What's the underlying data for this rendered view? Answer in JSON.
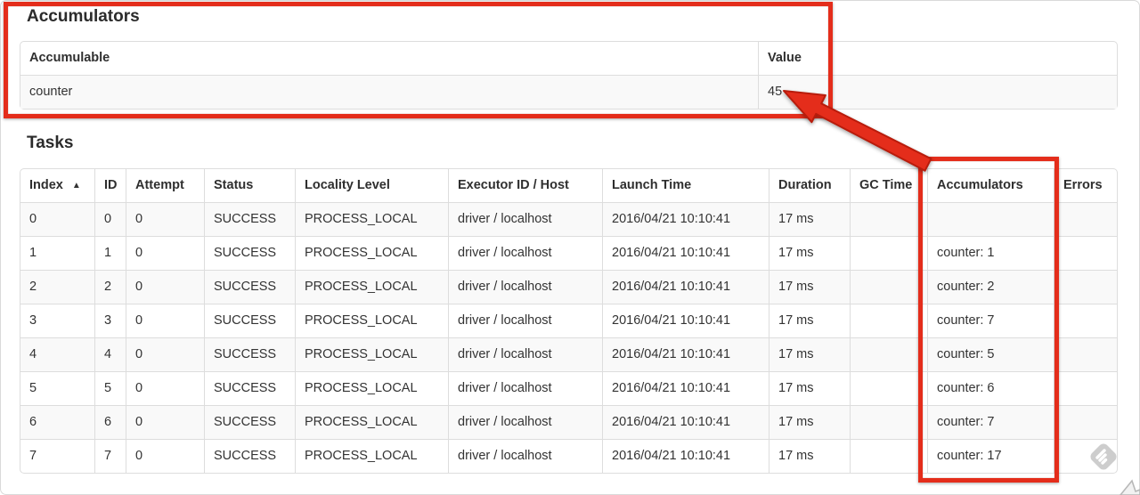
{
  "accumulators_section": {
    "title": "Accumulators",
    "table": {
      "columns": [
        "Accumulable",
        "Value"
      ],
      "rows": [
        [
          "counter",
          "45"
        ]
      ]
    }
  },
  "tasks_section": {
    "title": "Tasks",
    "table": {
      "columns": [
        "Index",
        "ID",
        "Attempt",
        "Status",
        "Locality Level",
        "Executor ID / Host",
        "Launch Time",
        "Duration",
        "GC Time",
        "Accumulators",
        "Errors"
      ],
      "sort_indicator": "▲",
      "rows": [
        [
          "0",
          "0",
          "0",
          "SUCCESS",
          "PROCESS_LOCAL",
          "driver / localhost",
          "2016/04/21 10:10:41",
          "17 ms",
          "",
          "",
          ""
        ],
        [
          "1",
          "1",
          "0",
          "SUCCESS",
          "PROCESS_LOCAL",
          "driver / localhost",
          "2016/04/21 10:10:41",
          "17 ms",
          "",
          "counter: 1",
          ""
        ],
        [
          "2",
          "2",
          "0",
          "SUCCESS",
          "PROCESS_LOCAL",
          "driver / localhost",
          "2016/04/21 10:10:41",
          "17 ms",
          "",
          "counter: 2",
          ""
        ],
        [
          "3",
          "3",
          "0",
          "SUCCESS",
          "PROCESS_LOCAL",
          "driver / localhost",
          "2016/04/21 10:10:41",
          "17 ms",
          "",
          "counter: 7",
          ""
        ],
        [
          "4",
          "4",
          "0",
          "SUCCESS",
          "PROCESS_LOCAL",
          "driver / localhost",
          "2016/04/21 10:10:41",
          "17 ms",
          "",
          "counter: 5",
          ""
        ],
        [
          "5",
          "5",
          "0",
          "SUCCESS",
          "PROCESS_LOCAL",
          "driver / localhost",
          "2016/04/21 10:10:41",
          "17 ms",
          "",
          "counter: 6",
          ""
        ],
        [
          "6",
          "6",
          "0",
          "SUCCESS",
          "PROCESS_LOCAL",
          "driver / localhost",
          "2016/04/21 10:10:41",
          "17 ms",
          "",
          "counter: 7",
          ""
        ],
        [
          "7",
          "7",
          "0",
          "SUCCESS",
          "PROCESS_LOCAL",
          "driver / localhost",
          "2016/04/21 10:10:41",
          "17 ms",
          "",
          "counter: 17",
          ""
        ]
      ]
    }
  },
  "annotations": {
    "color": "#e42d1b"
  }
}
